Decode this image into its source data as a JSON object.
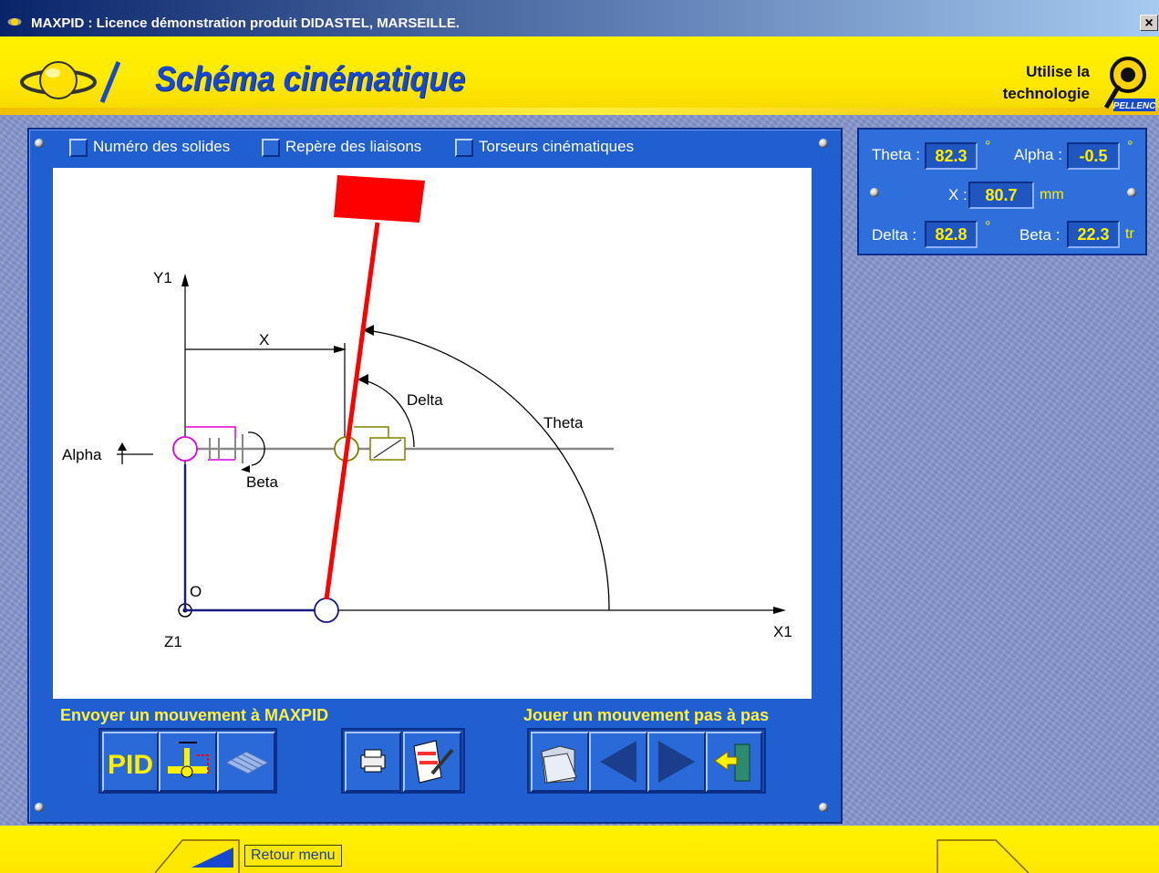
{
  "window": {
    "title": "MAXPID : Licence démonstration produit DIDASTEL, MARSEILLE.",
    "close_glyph": "×"
  },
  "header": {
    "title": "Schéma cinématique",
    "tech_line1": "Utilise la",
    "tech_line2": "technologie",
    "brand": "PELLENC"
  },
  "options": {
    "numero_solides": "Numéro des solides",
    "repere_liaisons": "Repère des liaisons",
    "torseurs": "Torseurs cinématiques"
  },
  "diagram": {
    "y_axis": "Y1",
    "x_axis": "X1",
    "z_axis": "Z1",
    "origin": "O",
    "x_label": "X",
    "delta_label": "Delta",
    "theta_label": "Theta",
    "alpha_label": "Alpha",
    "beta_label": "Beta"
  },
  "sections": {
    "send": "Envoyer un mouvement à MAXPID",
    "play": "Jouer un mouvement pas à pas"
  },
  "buttons": {
    "pid": "PID"
  },
  "readouts": {
    "theta_label": "Theta :",
    "theta_value": "82.3",
    "theta_unit": "°",
    "alpha_label": "Alpha :",
    "alpha_value": "-0.5",
    "alpha_unit": "°",
    "x_label": "X :",
    "x_value": "80.7",
    "x_unit": "mm",
    "delta_label": "Delta :",
    "delta_value": "82.8",
    "delta_unit": "°",
    "beta_label": "Beta :",
    "beta_value": "22.3",
    "beta_unit": "tr"
  },
  "footer": {
    "retour": "Retour menu"
  },
  "colors": {
    "panel": "#1f5fcf",
    "accent_yellow": "#ffef00",
    "arm": "#ff0000"
  }
}
